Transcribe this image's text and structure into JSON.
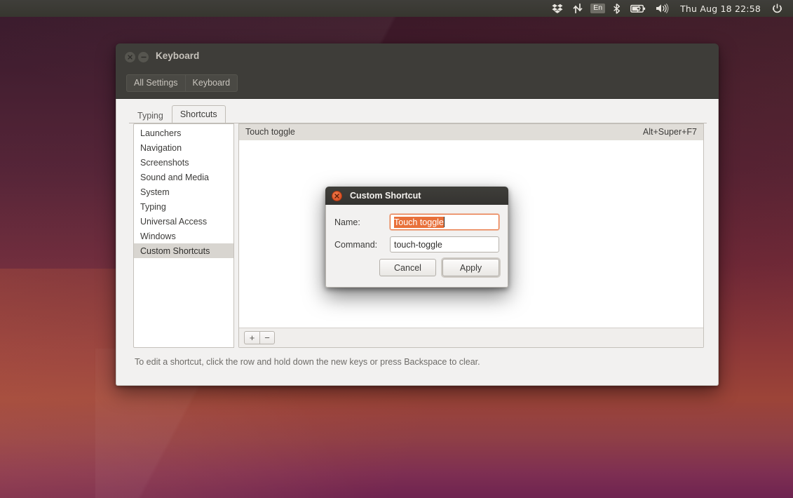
{
  "panel": {
    "indicators": [
      {
        "name": "dropbox-icon",
        "label": "Dropbox"
      },
      {
        "name": "network-icon",
        "label": "Network"
      },
      {
        "name": "keyboard-layout-indicator",
        "label": "En"
      },
      {
        "name": "bluetooth-icon",
        "label": "Bluetooth"
      },
      {
        "name": "battery-icon",
        "label": "Battery charging"
      },
      {
        "name": "volume-icon",
        "label": "Volume"
      }
    ],
    "clock": "Thu Aug 18 22:58",
    "session_icon": "power-gear-icon"
  },
  "window": {
    "title": "Keyboard",
    "breadcrumb": [
      "All Settings",
      "Keyboard"
    ],
    "tabs": [
      {
        "label": "Typing",
        "active": false
      },
      {
        "label": "Shortcuts",
        "active": true
      }
    ],
    "categories": [
      {
        "label": "Launchers",
        "selected": false
      },
      {
        "label": "Navigation",
        "selected": false
      },
      {
        "label": "Screenshots",
        "selected": false
      },
      {
        "label": "Sound and Media",
        "selected": false
      },
      {
        "label": "System",
        "selected": false
      },
      {
        "label": "Typing",
        "selected": false
      },
      {
        "label": "Universal Access",
        "selected": false
      },
      {
        "label": "Windows",
        "selected": false
      },
      {
        "label": "Custom Shortcuts",
        "selected": true
      }
    ],
    "shortcuts": [
      {
        "name": "Touch toggle",
        "binding": "Alt+Super+F7"
      }
    ],
    "toolbar": {
      "add_label": "+",
      "remove_label": "−"
    },
    "hint": "To edit a shortcut, click the row and hold down the new keys or press Backspace to clear."
  },
  "dialog": {
    "title": "Custom Shortcut",
    "name_label": "Name:",
    "name_value": "Touch toggle",
    "command_label": "Command:",
    "command_value": "touch-toggle",
    "cancel_label": "Cancel",
    "apply_label": "Apply"
  },
  "colors": {
    "accent_orange": "#E8703A",
    "titlebar": "#3E3D39",
    "window_bg": "#F2F1F0",
    "selection_row": "#D8D5D0"
  }
}
